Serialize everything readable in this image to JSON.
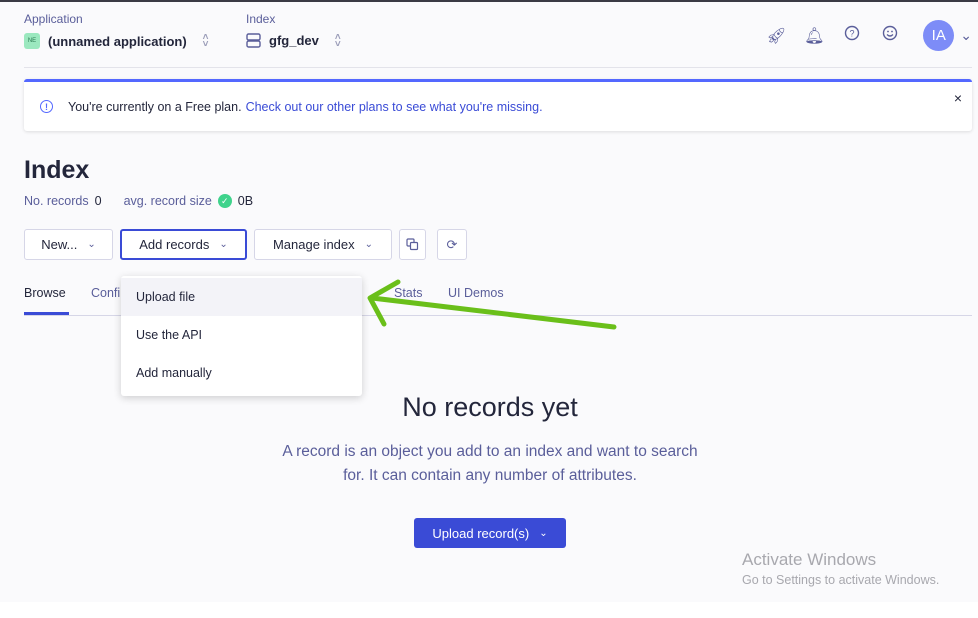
{
  "topbar": {
    "application": {
      "label": "Application",
      "badge": "NE",
      "value": "(unnamed application)"
    },
    "index": {
      "label": "Index",
      "value": "gfg_dev"
    },
    "icons": [
      "rocket-icon",
      "bell-icon",
      "help-icon",
      "smiley-icon"
    ],
    "avatar": "IA"
  },
  "banner": {
    "text": "You're currently on a Free plan.",
    "link": "Check out our other plans to see what you're missing.",
    "close": "×"
  },
  "page": {
    "title": "Index",
    "records_label": "No. records",
    "records": "0",
    "size_label": "avg. record size",
    "size": "0B"
  },
  "toolbar": {
    "new": "New...",
    "add_records": "Add records",
    "manage_index": "Manage index"
  },
  "tabs": [
    "Browse",
    "Confi",
    "Stats",
    "UI Demos"
  ],
  "menu": [
    "Upload file",
    "Use the API",
    "Add manually"
  ],
  "empty": {
    "title": "No records yet",
    "text": "A record is an object you add to an index and want to search for. It can contain any number of attributes.",
    "button": "Upload record(s)"
  },
  "watermark": {
    "title": "Activate Windows",
    "subtitle": "Go to Settings to activate Windows."
  },
  "colors": {
    "accent": "#3a4bd6",
    "annotation_arrow": "#6abf1a"
  }
}
